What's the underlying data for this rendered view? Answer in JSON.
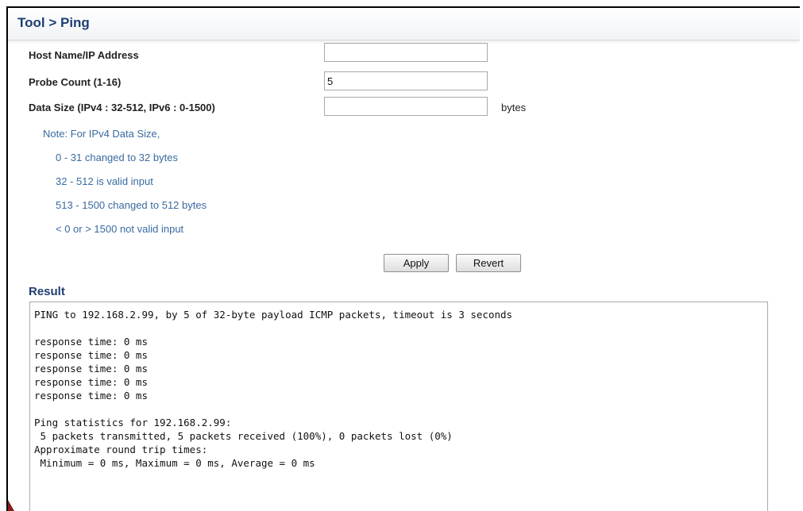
{
  "header": {
    "title": "Tool > Ping"
  },
  "form": {
    "host_label": "Host Name/IP Address",
    "host_value": "",
    "probe_label": "Probe Count (1-16)",
    "probe_value": "5",
    "size_label": "Data Size (IPv4 : 32-512, IPv6 : 0-1500)",
    "size_value": "",
    "size_unit": "bytes",
    "note_lines": [
      "Note: For IPv4 Data Size,",
      "0 - 31 changed to 32 bytes",
      "32 - 512 is valid input",
      "513 - 1500 changed to 512 bytes",
      "< 0 or > 1500 not valid input"
    ],
    "apply_label": "Apply",
    "revert_label": "Revert"
  },
  "result": {
    "heading": "Result",
    "lines": [
      "PING to 192.168.2.99, by 5 of 32-byte payload ICMP packets, timeout is 3 seconds",
      "",
      "response time: 0 ms",
      "response time: 0 ms",
      "response time: 0 ms",
      "response time: 0 ms",
      "response time: 0 ms",
      "",
      "Ping statistics for 192.168.2.99:",
      " 5 packets transmitted, 5 packets received (100%), 0 packets lost (0%)",
      "Approximate round trip times:",
      " Minimum = 0 ms, Maximum = 0 ms, Average = 0 ms"
    ]
  }
}
